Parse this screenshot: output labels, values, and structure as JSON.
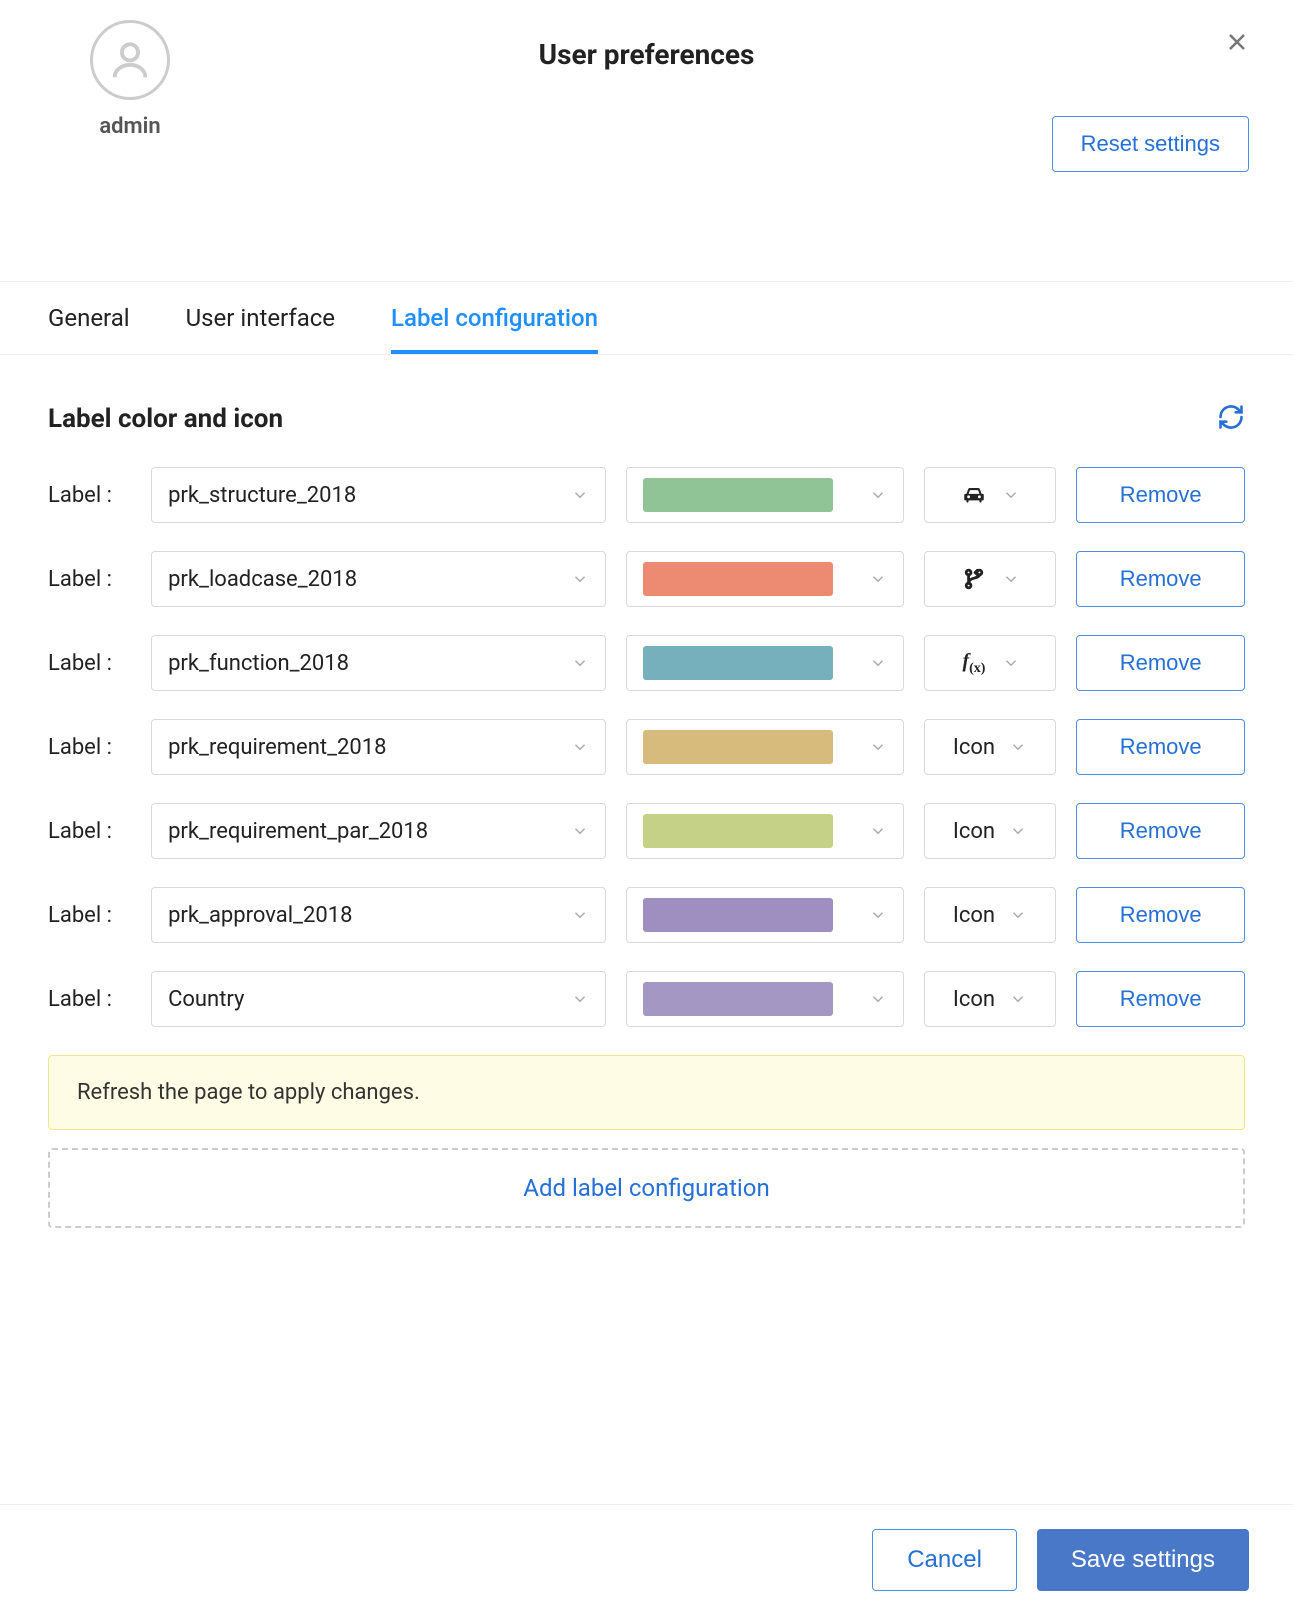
{
  "header": {
    "title": "User preferences",
    "username": "admin",
    "reset_label": "Reset settings"
  },
  "tabs": [
    {
      "label": "General",
      "active": false
    },
    {
      "label": "User interface",
      "active": false
    },
    {
      "label": "Label configuration",
      "active": true
    }
  ],
  "section": {
    "title": "Label color and icon",
    "row_label": "Label :",
    "remove_label": "Remove",
    "icon_placeholder": "Icon",
    "add_label": "Add label configuration",
    "alert": "Refresh the page to apply changes."
  },
  "rows": [
    {
      "name": "prk_structure_2018",
      "color": "#90c497",
      "icon": "car"
    },
    {
      "name": "prk_loadcase_2018",
      "color": "#ec8b72",
      "icon": "branch"
    },
    {
      "name": "prk_function_2018",
      "color": "#77b0bd",
      "icon": "fx"
    },
    {
      "name": "prk_requirement_2018",
      "color": "#d6bb7d",
      "icon": ""
    },
    {
      "name": "prk_requirement_par_2018",
      "color": "#c4d186",
      "icon": ""
    },
    {
      "name": "prk_approval_2018",
      "color": "#9f8fc0",
      "icon": ""
    },
    {
      "name": "Country",
      "color": "#a497c4",
      "icon": ""
    }
  ],
  "footer": {
    "cancel_label": "Cancel",
    "save_label": "Save settings"
  }
}
